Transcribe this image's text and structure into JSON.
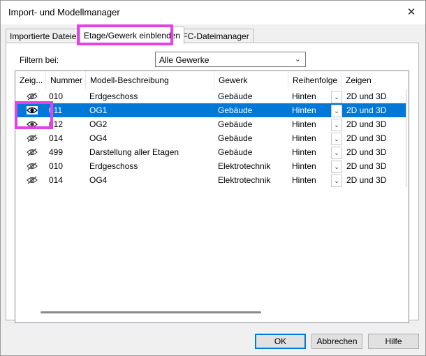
{
  "window": {
    "title": "Import- und Modellmanager",
    "close_glyph": "✕"
  },
  "tabs": [
    {
      "label": "Importierte Dateien",
      "active": false
    },
    {
      "label": "Etage/Gewerk einblenden",
      "active": true
    },
    {
      "label": "IFC-Dateimanager",
      "active": false
    }
  ],
  "filter": {
    "label": "Filtern bei:",
    "value": "Alle Gewerke"
  },
  "table": {
    "headers": [
      "Zeig...",
      "Nummer",
      "Modell-Beschreibung",
      "Gewerk",
      "Reihenfolge",
      "Zeigen"
    ],
    "rows": [
      {
        "icon": "eye-hidden-icon",
        "nummer": "010",
        "beschreibung": "Erdgeschoss",
        "gewerk": "Gebäude",
        "reihenfolge": "Hinten",
        "zeigen": "2D und 3D",
        "selected": false
      },
      {
        "icon": "eye-icon",
        "nummer": "011",
        "beschreibung": "OG1",
        "gewerk": "Gebäude",
        "reihenfolge": "Hinten",
        "zeigen": "2D und 3D",
        "selected": true
      },
      {
        "icon": "eye-icon",
        "nummer": "012",
        "beschreibung": "OG2",
        "gewerk": "Gebäude",
        "reihenfolge": "Hinten",
        "zeigen": "2D und 3D",
        "selected": false
      },
      {
        "icon": "eye-hidden-icon",
        "nummer": "014",
        "beschreibung": "OG4",
        "gewerk": "Gebäude",
        "reihenfolge": "Hinten",
        "zeigen": "2D und 3D",
        "selected": false
      },
      {
        "icon": "eye-hidden-icon",
        "nummer": "499",
        "beschreibung": "Darstellung aller Etagen",
        "gewerk": "Gebäude",
        "reihenfolge": "Hinten",
        "zeigen": "2D und 3D",
        "selected": false
      },
      {
        "icon": "eye-hidden-icon",
        "nummer": "010",
        "beschreibung": "Erdgeschoss",
        "gewerk": "Elektrotechnik",
        "reihenfolge": "Hinten",
        "zeigen": "2D und 3D",
        "selected": false
      },
      {
        "icon": "eye-hidden-icon",
        "nummer": "014",
        "beschreibung": "OG4",
        "gewerk": "Elektrotechnik",
        "reihenfolge": "Hinten",
        "zeigen": "2D und 3D",
        "selected": false
      }
    ]
  },
  "buttons": {
    "ok": "OK",
    "cancel": "Abbrechen",
    "help": "Hilfe"
  },
  "colors": {
    "selection": "#0078d7",
    "highlight": "#e541e8"
  }
}
